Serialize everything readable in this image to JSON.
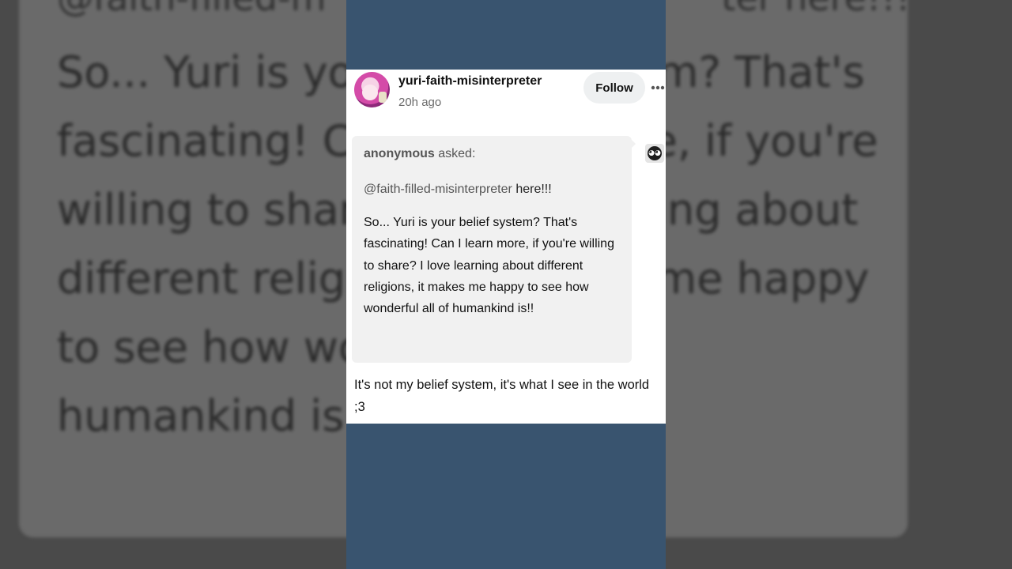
{
  "post": {
    "username": "yuri-faith-misinterpreter",
    "timestamp": "20h ago",
    "follow_label": "Follow",
    "more_icon": "ellipsis-icon",
    "avatar_icon": "avatar"
  },
  "ask": {
    "asker_name": "anonymous",
    "asked_label": "asked:",
    "mention": "@faith-filled-misinterpreter",
    "mention_suffix": "here!!!",
    "body": "So... Yuri is your belief system? That's fascinating! Can I learn more, if you're willing to share? I love learning about different religions, it makes me happy to see how wonderful all of humankind is!!",
    "anon_avatar_icon": "anonymous-avatar-icon"
  },
  "answer": {
    "text": "It's not my belief system, it's what I see in the world ;3"
  },
  "background": {
    "handle_fragment": "@faith-filled-m",
    "handle_fragment_right": "ter here!!!",
    "text": "So... Yuri is your belief system? That's fascinating! Can I learn more, if you're willing to share? I love learning about different religions, it makes me happy to see how wonderful all of humankind is!!"
  },
  "colors": {
    "column_bg": "#39546f",
    "card_bg": "#ffffff",
    "ask_bg": "#f1f1f1"
  }
}
